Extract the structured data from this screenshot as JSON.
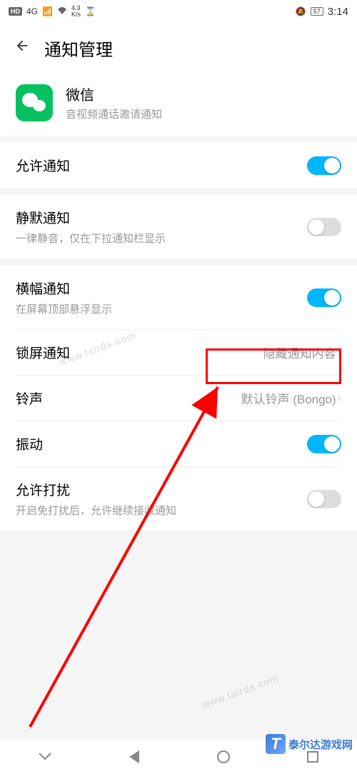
{
  "status_bar": {
    "hd": "HD",
    "net_4g": "4G",
    "speed_val": "4.3",
    "speed_unit": "K/s",
    "battery": "57",
    "time": "3:14"
  },
  "header": {
    "title": "通知管理"
  },
  "app": {
    "name": "微信",
    "subtitle": "音视频通话邀请通知"
  },
  "allow_notify": {
    "title": "允许通知",
    "enabled": true
  },
  "silent": {
    "title": "静默通知",
    "subtitle": "一律静音，仅在下拉通知栏显示",
    "enabled": false
  },
  "banner": {
    "title": "横幅通知",
    "subtitle": "在屏幕顶部悬浮显示",
    "enabled": true
  },
  "lockscreen": {
    "title": "锁屏通知",
    "value": "隐藏通知内容"
  },
  "ringtone": {
    "title": "铃声",
    "value": "默认铃声 (Bongo)"
  },
  "vibrate": {
    "title": "振动",
    "enabled": true
  },
  "disturb": {
    "title": "允许打扰",
    "subtitle": "开启免打扰后，允许继续接收通知",
    "enabled": false
  },
  "watermark": {
    "logo": "T",
    "text": "泰尔达游戏网",
    "url": "www.tairda.com"
  }
}
